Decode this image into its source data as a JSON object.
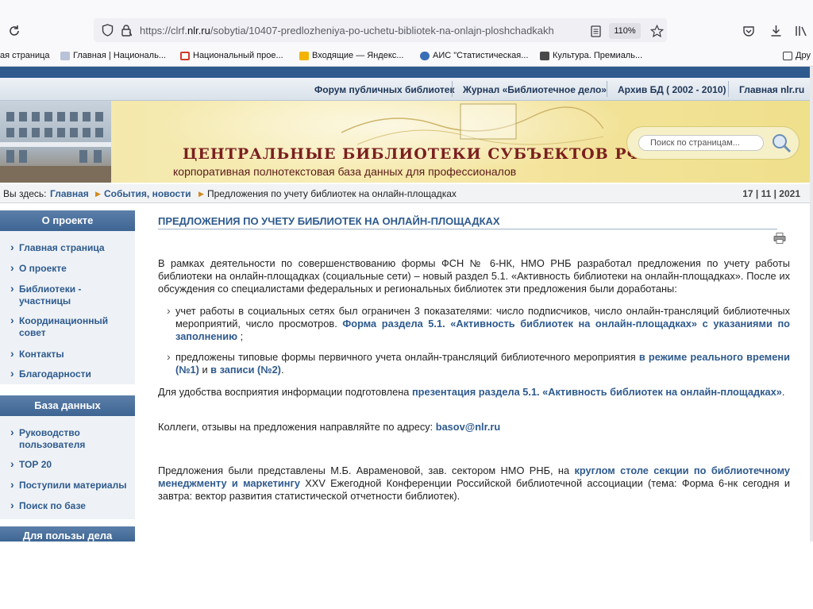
{
  "browser": {
    "url_prefix": "https://clrf.",
    "url_domain": "nlr.ru",
    "url_path": "/sobytia/10407-predlozheniya-po-uchetu-bibliotek-na-onlajn-ploshchadkakh",
    "zoom": "110%"
  },
  "bookmarks": [
    {
      "label": "ая страница",
      "color": "#ffffff"
    },
    {
      "label": "Главная | Националь...",
      "color": "#b9c3d8"
    },
    {
      "label": "Национальный прое...",
      "color": "#d23b2e"
    },
    {
      "label": "Входящие — Яндекс...",
      "color": "#f2b400"
    },
    {
      "label": "АИС \"Статистическая...",
      "color": "#3a6fb5"
    },
    {
      "label": "Культура. Премиаль...",
      "color": "#4a4a4a"
    },
    {
      "label": "Дру",
      "color": "#ffffff"
    }
  ],
  "topnav": {
    "forum": "Форум публичных библиотек",
    "journal": "Журнал «Библиотечное дело»",
    "archive": "Архив БД ( 2002 - 2010)",
    "home": "Главная nlr.ru"
  },
  "banner": {
    "title": "ЦЕНТРАЛЬНЫЕ БИБЛИОТЕКИ СУБЪЕКТОВ РФ",
    "subtitle": "корпоративная полнотекстовая база данных для профессионалов",
    "search_placeholder": "Поиск по страницам..."
  },
  "breadcrumb": {
    "prefix": "Вы здесь:",
    "home": "Главная",
    "events": "События, новости",
    "current": "Предложения по учету библиотек на онлайн-площадках",
    "date": "17 | 11 | 2021"
  },
  "sidebar": {
    "about_head": "О проекте",
    "about_items": [
      "Главная страница",
      "О проекте",
      "Библиотеки - участницы",
      "Координационный совет",
      "Контакты",
      "Благодарности"
    ],
    "db_head": "База данных",
    "db_items": [
      "Руководство пользователя",
      "ТОР 20",
      "Поступили материалы",
      "Поиск по базе"
    ],
    "benefit_head": "Для пользы дела"
  },
  "article": {
    "title": "ПРЕДЛОЖЕНИЯ ПО УЧЕТУ БИБЛИОТЕК НА ОНЛАЙН-ПЛОЩАДКАХ",
    "p1": "В рамках деятельности по совершенствованию формы ФСН № 6-НК, НМО РНБ разработал предложения по учету работы библиотеки на онлайн-площадках (социальные сети) – новый раздел 5.1. «Активность библиотеки на онлайн-площадках». После их обсуждения со специалистами федеральных и региональных библиотек эти предложения были доработаны:",
    "b1_text": "учет работы в социальных сетях был ограничен 3 показателями: число подписчиков, число онлайн-трансляций библиотечных мероприятий, число просмотров. ",
    "b1_link": "Форма раздела 5.1. «Активность библиотек на онлайн-площадках» с указаниями по заполнению",
    "b1_end": " ;",
    "b2_text": "предложены типовые формы первичного учета онлайн-трансляций библиотечного мероприятия ",
    "b2_link1": "в режиме реального времени (№1)",
    "b2_mid": " и ",
    "b2_link2": "в записи (№2)",
    "b2_end": ".",
    "p2_text": "Для удобства восприятия информации подготовлена ",
    "p2_link": "презентация раздела 5.1. «Активность библиотек на онлайн-площадках»",
    "p2_end": ".",
    "p3_text": "Коллеги, отзывы на предложения направляйте по адресу: ",
    "p3_email": "basov@nlr.ru",
    "p4_text": "Предложения были представлены М.Б. Авраменовой, зав. сектором НМО РНБ, на ",
    "p4_link": "круглом столе секции по библиотечному менеджменту и маркетингу",
    "p4_end": " XXV Ежегодной Конференции Российской библиотечной ассоциации (тема: Форма 6-нк сегодня и завтра: вектор развития статистической отчетности библиотек)."
  }
}
